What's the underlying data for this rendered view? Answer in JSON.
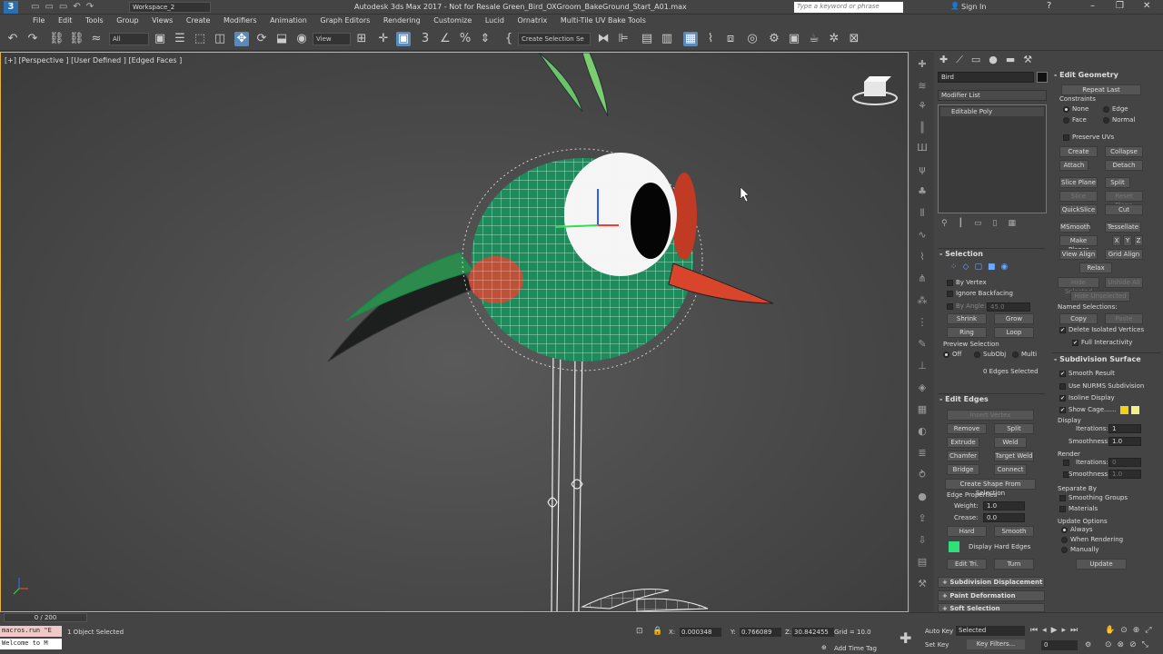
{
  "window": {
    "title": "Autodesk 3ds Max 2017 - Not for Resale   Green_Bird_OXGroom_BakeGround_Start_A01.max",
    "workspace": "Workspace_2",
    "search_placeholder": "Type a keyword or phrase",
    "sign_in": "Sign In"
  },
  "menu": [
    "File",
    "Edit",
    "Tools",
    "Group",
    "Views",
    "Create",
    "Modifiers",
    "Animation",
    "Graph Editors",
    "Rendering",
    "Customize",
    "Lucid",
    "Ornatrix",
    "Multi-Tile UV Bake Tools"
  ],
  "toolbar": {
    "filter": "All",
    "refcoord": "View",
    "selset": "Create Selection Se"
  },
  "viewport": {
    "label": "[+] [Perspective ] [User Defined ] [Edged Faces ]"
  },
  "command_panel": {
    "object_name": "Bird",
    "modifier_list": "Modifier List",
    "stack_item": "Editable Poly",
    "selection": {
      "title": "Selection",
      "by_vertex": "By Vertex",
      "ignore_backfacing": "Ignore Backfacing",
      "by_angle": "By Angle:",
      "by_angle_val": "45.0",
      "shrink": "Shrink",
      "grow": "Grow",
      "ring": "Ring",
      "loop": "Loop",
      "preview": "Preview Selection",
      "off": "Off",
      "subobj": "SubObj",
      "multi": "Multi",
      "status": "0 Edges Selected"
    },
    "edit_edges": {
      "title": "Edit Edges",
      "insert_vertex": "Insert Vertex",
      "remove": "Remove",
      "split": "Split",
      "extrude": "Extrude",
      "weld": "Weld",
      "chamfer": "Chamfer",
      "target_weld": "Target Weld",
      "bridge": "Bridge",
      "connect": "Connect",
      "create_shape": "Create Shape From Selection",
      "edge_props": "Edge Properties",
      "weight": "Weight:",
      "weight_val": "1.0",
      "crease": "Crease:",
      "crease_val": "0.0",
      "hard": "Hard",
      "smooth": "Smooth",
      "display_hard": "Display Hard Edges",
      "edit_tri": "Edit Tri.",
      "turn": "Turn"
    },
    "collapsed": [
      "Subdivision Displacement",
      "Paint Deformation",
      "Soft Selection"
    ],
    "edit_geometry": {
      "title": "Edit Geometry",
      "repeat_last": "Repeat Last",
      "constraints": "Constraints",
      "none": "None",
      "edge": "Edge",
      "face": "Face",
      "normal": "Normal",
      "preserve_uvs": "Preserve UVs",
      "create": "Create",
      "collapse": "Collapse",
      "attach": "Attach",
      "detach": "Detach",
      "slice_plane": "Slice Plane",
      "split": "Split",
      "slice": "Slice",
      "reset_plane": "Reset Plane",
      "quickslice": "QuickSlice",
      "cut": "Cut",
      "msmooth": "MSmooth",
      "tessellate": "Tessellate",
      "make_planar": "Make Planar",
      "x": "X",
      "y": "Y",
      "z": "Z",
      "view_align": "View Align",
      "grid_align": "Grid Align",
      "relax": "Relax",
      "hide_selected": "Hide Selected",
      "unhide_all": "Unhide All",
      "hide_unselected": "Hide Unselected",
      "named_sel": "Named Selections:",
      "copy": "Copy",
      "paste": "Paste",
      "delete_iso": "Delete Isolated Vertices",
      "full_interactivity": "Full Interactivity"
    },
    "subdivision": {
      "title": "Subdivision Surface",
      "smooth_result": "Smooth Result",
      "use_nurms": "Use NURMS Subdivision",
      "isoline": "Isoline Display",
      "show_cage": "Show Cage......",
      "display": "Display",
      "iterations": "Iterations:",
      "iter_val": "1",
      "smoothness": "Smoothness:",
      "smooth_val": "1.0",
      "render": "Render",
      "r_iter_val": "0",
      "r_smooth_val": "1.0",
      "separate_by": "Separate By",
      "smoothing_groups": "Smoothing Groups",
      "materials": "Materials",
      "update_options": "Update Options",
      "always": "Always",
      "when_rendering": "When Rendering",
      "manually": "Manually",
      "update": "Update"
    }
  },
  "status": {
    "timeline": "0 / 200",
    "macro1": "macros.run \"E",
    "macro2": "Welcome to M",
    "selected": "1 Object Selected",
    "x": "0.000348",
    "y": "0.766089",
    "z": "30.842455",
    "grid": "Grid = 10.0",
    "add_time_tag": "Add Time Tag",
    "auto_key": "Auto Key",
    "set_key": "Set Key",
    "selected_drop": "Selected",
    "key_filters": "Key Filters...",
    "frame": "0"
  },
  "colors": {
    "accent": "#e5b13a",
    "bird_green": "#1f8a5c",
    "beak": "#d9452a",
    "hard_edge": "#2fe07a"
  }
}
